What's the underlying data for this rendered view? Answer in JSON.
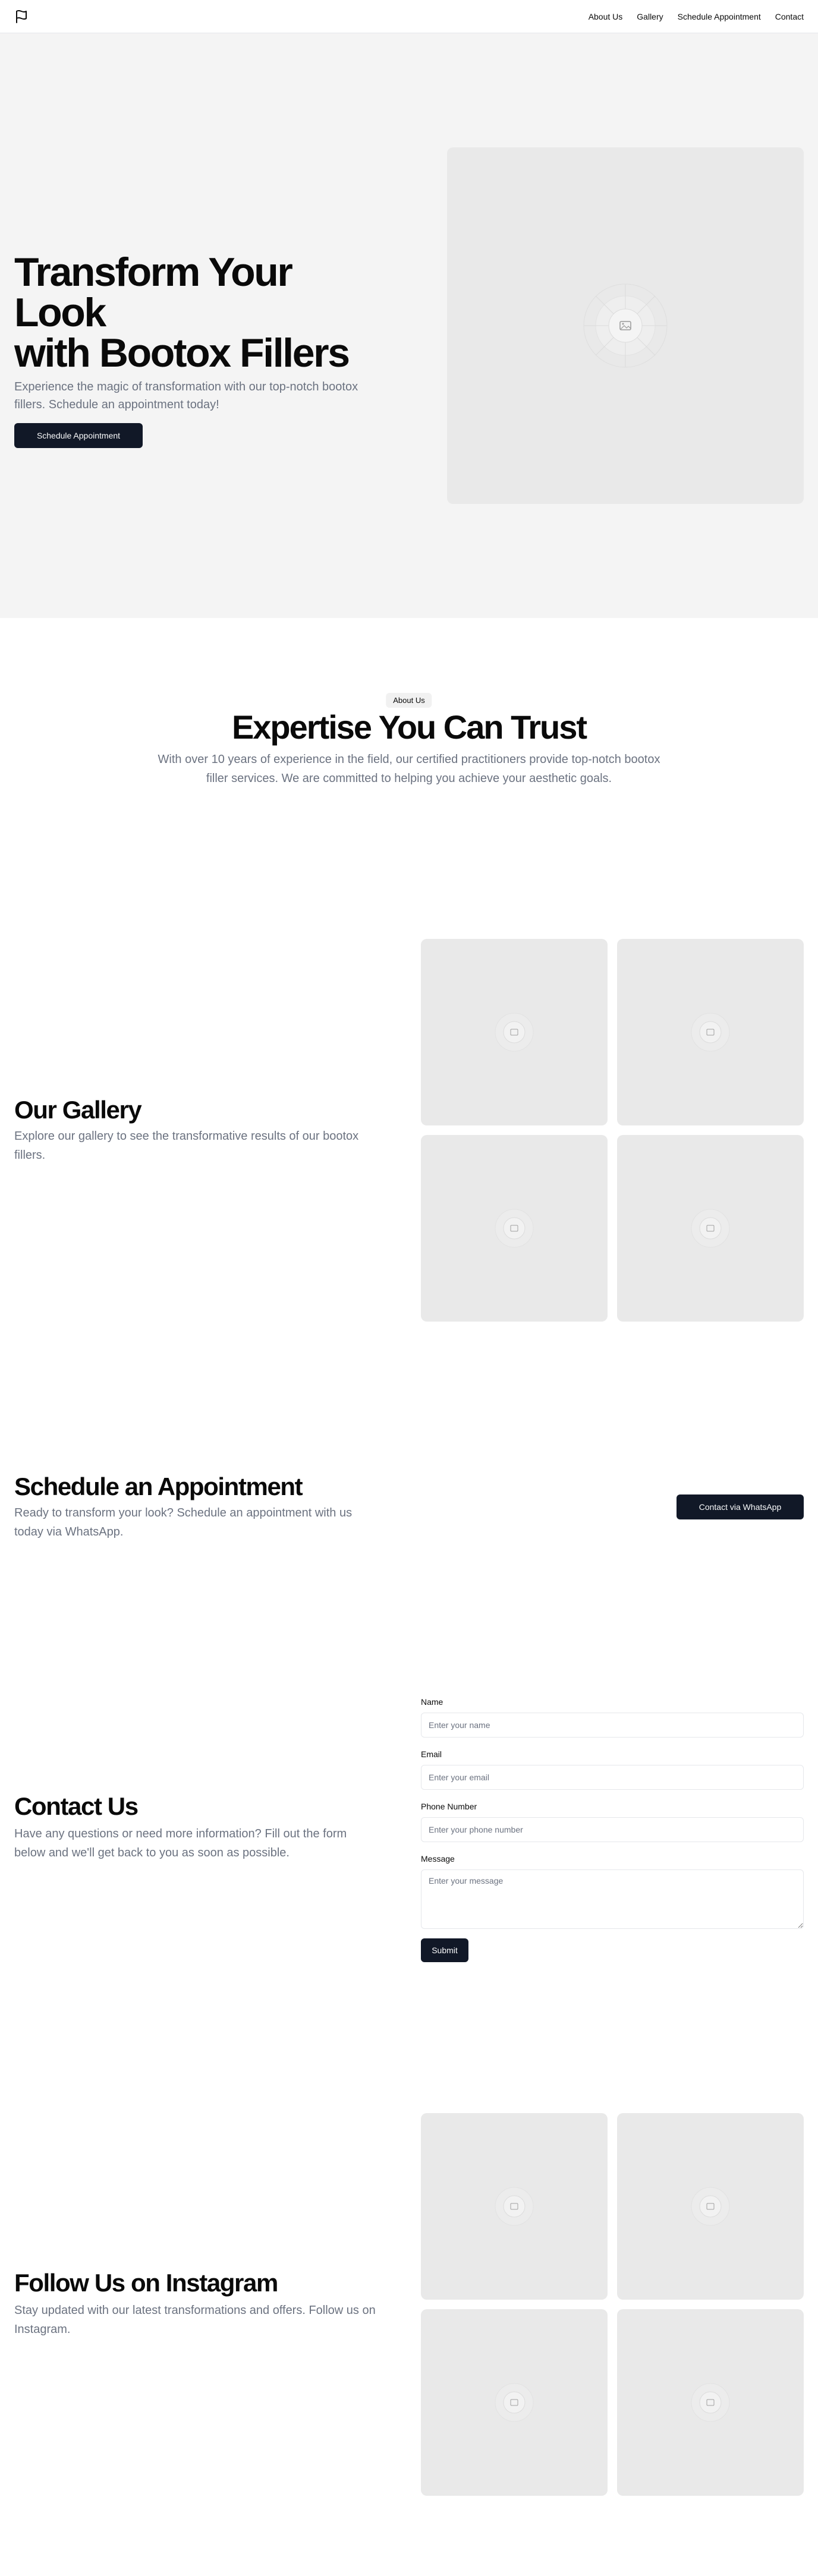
{
  "header": {
    "logo_icon": "flag-icon",
    "nav": [
      {
        "label": "About Us"
      },
      {
        "label": "Gallery"
      },
      {
        "label": "Schedule Appointment"
      },
      {
        "label": "Contact"
      }
    ]
  },
  "hero": {
    "title_line1": "Transform Your Look",
    "title_line2": "with Bootox Fillers",
    "subtitle": "Experience the magic of transformation with our top-notch bootox fillers. Schedule an appointment today!",
    "button_label": "Schedule Appointment",
    "image_icon": "image-placeholder-icon"
  },
  "about": {
    "badge": "About Us",
    "title": "Expertise You Can Trust",
    "text": "With over 10 years of experience in the field, our certified practitioners provide top-notch bootox filler services. We are committed to helping you achieve your aesthetic goals."
  },
  "gallery": {
    "title": "Our Gallery",
    "text": "Explore our gallery to see the transformative results of our bootox fillers."
  },
  "appointment": {
    "title": "Schedule an Appointment",
    "text": "Ready to transform your look? Schedule an appointment with us today via WhatsApp.",
    "button_label": "Contact via WhatsApp"
  },
  "contact": {
    "title": "Contact Us",
    "text": "Have any questions or need more information? Fill out the form below and we'll get back to you as soon as possible.",
    "fields": {
      "name_label": "Name",
      "name_placeholder": "Enter your name",
      "email_label": "Email",
      "email_placeholder": "Enter your email",
      "phone_label": "Phone Number",
      "phone_placeholder": "Enter your phone number",
      "message_label": "Message",
      "message_placeholder": "Enter your message"
    },
    "submit_label": "Submit"
  },
  "instagram": {
    "title": "Follow Us on Instagram",
    "text": "Stay updated with our latest transformations and offers. Follow us on Instagram."
  },
  "colors": {
    "primary_button": "#111827",
    "hero_background": "#f4f4f4",
    "placeholder": "#e9e9e9",
    "muted_text": "#6b7280"
  }
}
